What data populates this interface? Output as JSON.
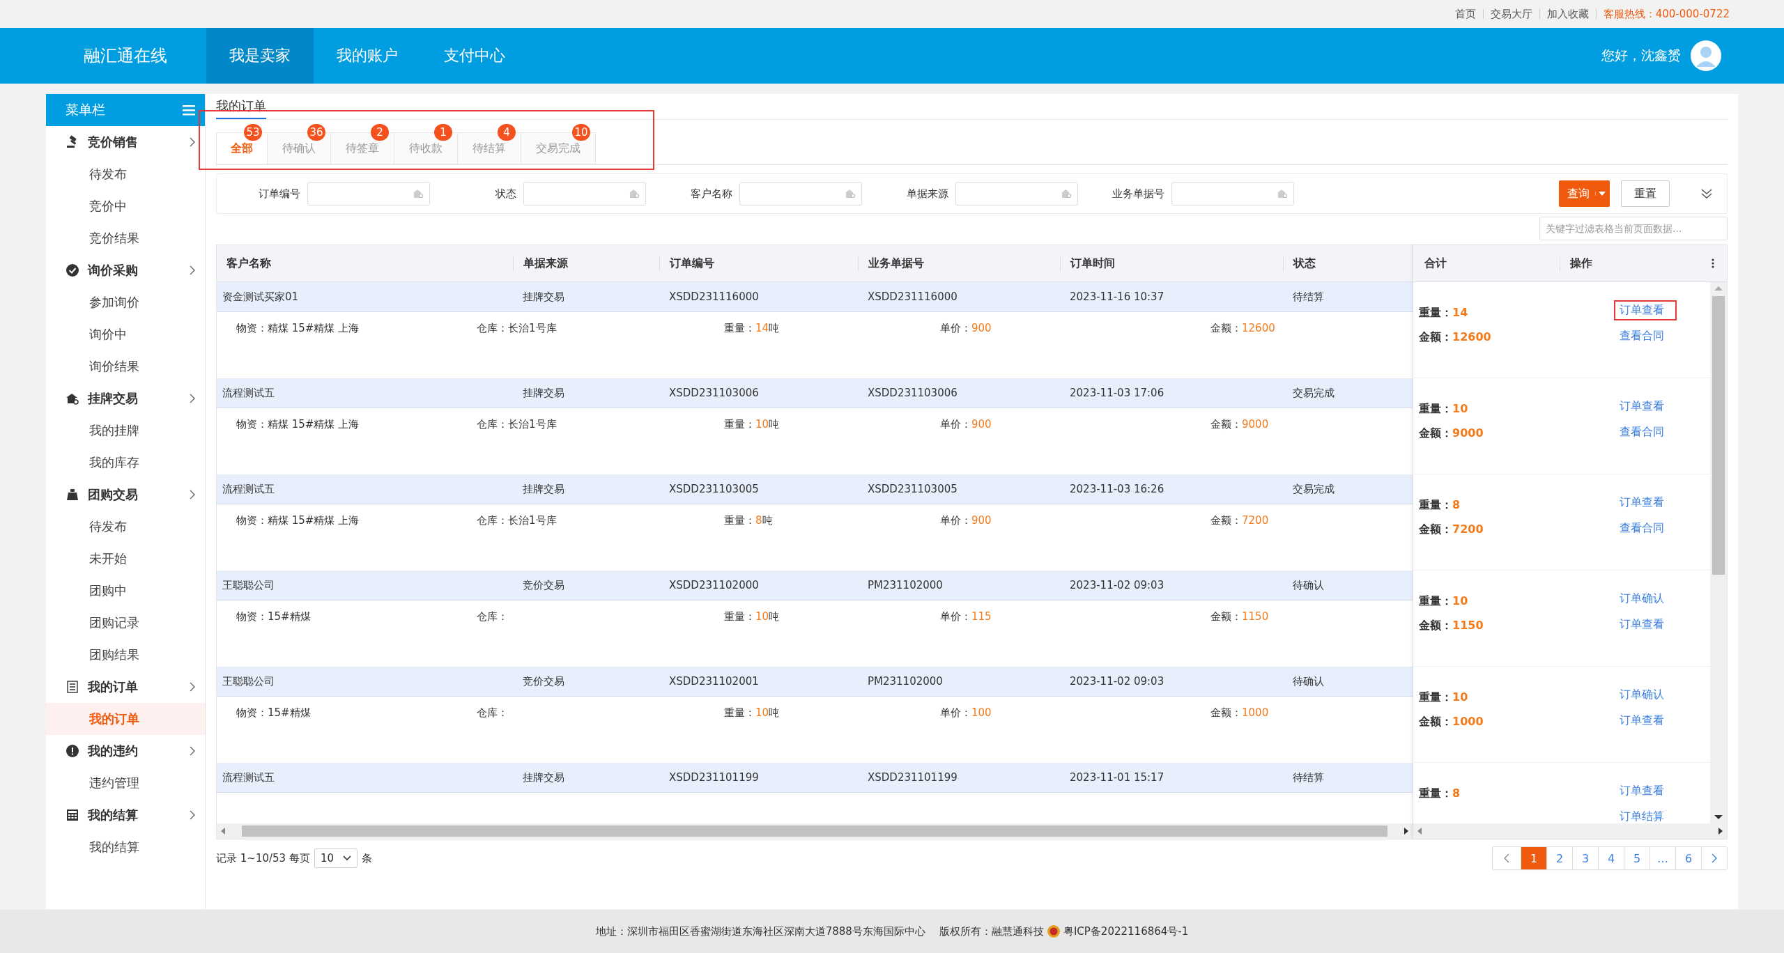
{
  "top_links": [
    {
      "label": "首页"
    },
    {
      "label": "交易大厅"
    },
    {
      "label": "加入收藏"
    }
  ],
  "hotline": "客服热线：400-000-0722",
  "header": {
    "logo": "融汇通在线",
    "nav": [
      {
        "label": "我是卖家",
        "selected": true
      },
      {
        "label": "我的账户",
        "selected": false
      },
      {
        "label": "支付中心",
        "selected": false
      }
    ],
    "greeting": "您好，沈鑫赟"
  },
  "sidebar": {
    "title": "菜单栏",
    "groups": [
      {
        "label": "竞价销售",
        "items": [
          {
            "label": "待发布",
            "selected": false
          },
          {
            "label": "竞价中",
            "selected": false
          },
          {
            "label": "竞价结果",
            "selected": false
          }
        ]
      },
      {
        "label": "询价采购",
        "items": [
          {
            "label": "参加询价",
            "selected": false
          },
          {
            "label": "询价中",
            "selected": false
          },
          {
            "label": "询价结果",
            "selected": false
          }
        ]
      },
      {
        "label": "挂牌交易",
        "items": [
          {
            "label": "我的挂牌",
            "selected": false
          },
          {
            "label": "我的库存",
            "selected": false
          }
        ]
      },
      {
        "label": "团购交易",
        "items": [
          {
            "label": "待发布",
            "selected": false
          },
          {
            "label": "未开始",
            "selected": false
          },
          {
            "label": "团购中",
            "selected": false
          },
          {
            "label": "团购记录",
            "selected": false
          },
          {
            "label": "团购结果",
            "selected": false
          }
        ]
      },
      {
        "label": "我的订单",
        "items": [
          {
            "label": "我的订单",
            "selected": true
          }
        ]
      },
      {
        "label": "我的违约",
        "items": [
          {
            "label": "违约管理",
            "selected": false
          }
        ]
      },
      {
        "label": "我的结算",
        "items": [
          {
            "label": "我的结算",
            "selected": false
          }
        ]
      }
    ]
  },
  "page_tab": "我的订单",
  "status_tabs": {
    "highlighted": true,
    "tabs": [
      {
        "label": "全部",
        "count": "53",
        "selected": true
      },
      {
        "label": "待确认",
        "count": "36",
        "selected": false
      },
      {
        "label": "待签章",
        "count": "2",
        "selected": false
      },
      {
        "label": "待收款",
        "count": "1",
        "selected": false
      },
      {
        "label": "待结算",
        "count": "4",
        "selected": false
      },
      {
        "label": "交易完成",
        "count": "10",
        "selected": false
      }
    ]
  },
  "filters": [
    {
      "label": "订单编号"
    },
    {
      "label": "状态"
    },
    {
      "label": "客户名称"
    },
    {
      "label": "单据来源"
    },
    {
      "label": "业务单据号"
    }
  ],
  "buttons": {
    "query": "查询",
    "reset": "重置"
  },
  "keyword_filter": {
    "placeholder": "关键字过滤表格当前页面数据..."
  },
  "table": {
    "columns": [
      "客户名称",
      "单据来源",
      "订单编号",
      "业务单据号",
      "订单时间",
      "状态"
    ],
    "total_columns": [
      "合计",
      "操作"
    ],
    "rows": [
      {
        "cells": [
          "资金测试买家01",
          "挂牌交易",
          "XSDD231116000",
          "XSDD231116000",
          "2023-11-16 10:37",
          "待结算"
        ],
        "detail": [
          {
            "label": "物资：",
            "value": "精煤 15#精煤 上海",
            "kind": "text"
          },
          {
            "label": "仓库：",
            "value": "长治1号库",
            "kind": "text"
          },
          {
            "label": "重量：",
            "value": "14",
            "unit": "吨",
            "kind": "number"
          },
          {
            "label": "单价：",
            "value": "900",
            "kind": "number"
          },
          {
            "label": "金额：",
            "value": "12600",
            "kind": "number"
          }
        ],
        "totals": [
          {
            "label": "重量：",
            "value": "14"
          },
          {
            "label": "金额：",
            "value": "12600"
          }
        ],
        "actions": [
          {
            "label": "订单查看",
            "highlighted": true
          },
          {
            "label": "查看合同",
            "highlighted": false
          }
        ]
      },
      {
        "cells": [
          "流程测试五",
          "挂牌交易",
          "XSDD231103006",
          "XSDD231103006",
          "2023-11-03 17:06",
          "交易完成"
        ],
        "detail": [
          {
            "label": "物资：",
            "value": "精煤 15#精煤 上海",
            "kind": "text"
          },
          {
            "label": "仓库：",
            "value": "长治1号库",
            "kind": "text"
          },
          {
            "label": "重量：",
            "value": "10",
            "unit": "吨",
            "kind": "number"
          },
          {
            "label": "单价：",
            "value": "900",
            "kind": "number"
          },
          {
            "label": "金额：",
            "value": "9000",
            "kind": "number"
          }
        ],
        "totals": [
          {
            "label": "重量：",
            "value": "10"
          },
          {
            "label": "金额：",
            "value": "9000"
          }
        ],
        "actions": [
          {
            "label": "订单查看",
            "highlighted": false
          },
          {
            "label": "查看合同",
            "highlighted": false
          }
        ]
      },
      {
        "cells": [
          "流程测试五",
          "挂牌交易",
          "XSDD231103005",
          "XSDD231103005",
          "2023-11-03 16:26",
          "交易完成"
        ],
        "detail": [
          {
            "label": "物资：",
            "value": "精煤 15#精煤 上海",
            "kind": "text"
          },
          {
            "label": "仓库：",
            "value": "长治1号库",
            "kind": "text"
          },
          {
            "label": "重量：",
            "value": "8",
            "unit": "吨",
            "kind": "number"
          },
          {
            "label": "单价：",
            "value": "900",
            "kind": "number"
          },
          {
            "label": "金额：",
            "value": "7200",
            "kind": "number"
          }
        ],
        "totals": [
          {
            "label": "重量：",
            "value": "8"
          },
          {
            "label": "金额：",
            "value": "7200"
          }
        ],
        "actions": [
          {
            "label": "订单查看",
            "highlighted": false
          },
          {
            "label": "查看合同",
            "highlighted": false
          }
        ]
      },
      {
        "cells": [
          "王聪聪公司",
          "竞价交易",
          "XSDD231102000",
          "PM231102000",
          "2023-11-02 09:03",
          "待确认"
        ],
        "detail": [
          {
            "label": "物资：",
            "value": "15#精煤",
            "kind": "text"
          },
          {
            "label": "仓库："
          },
          {
            "label": "重量：",
            "value": "10",
            "unit": "吨",
            "kind": "number"
          },
          {
            "label": "单价：",
            "value": "115",
            "kind": "number"
          },
          {
            "label": "金额：",
            "value": "1150",
            "kind": "number"
          }
        ],
        "totals": [
          {
            "label": "重量：",
            "value": "10"
          },
          {
            "label": "金额：",
            "value": "1150"
          }
        ],
        "actions": [
          {
            "label": "订单确认",
            "highlighted": false
          },
          {
            "label": "订单查看",
            "highlighted": false
          }
        ]
      },
      {
        "cells": [
          "王聪聪公司",
          "竞价交易",
          "XSDD231102001",
          "PM231102000",
          "2023-11-02 09:03",
          "待确认"
        ],
        "detail": [
          {
            "label": "物资：",
            "value": "15#精煤",
            "kind": "text"
          },
          {
            "label": "仓库："
          },
          {
            "label": "重量：",
            "value": "10",
            "unit": "吨",
            "kind": "number"
          },
          {
            "label": "单价：",
            "value": "100",
            "kind": "number"
          },
          {
            "label": "金额：",
            "value": "1000",
            "kind": "number"
          }
        ],
        "totals": [
          {
            "label": "重量：",
            "value": "10"
          },
          {
            "label": "金额：",
            "value": "1000"
          }
        ],
        "actions": [
          {
            "label": "订单确认",
            "highlighted": false
          },
          {
            "label": "订单查看",
            "highlighted": false
          }
        ]
      },
      {
        "cells": [
          "流程测试五",
          "挂牌交易",
          "XSDD231101199",
          "XSDD231101199",
          "2023-11-01 15:17",
          "待结算"
        ],
        "totals": [
          {
            "label": "重量：",
            "value": "8"
          }
        ],
        "actions": [
          {
            "label": "订单查看",
            "highlighted": false
          },
          {
            "label": "订单结算",
            "highlighted": false
          }
        ]
      }
    ]
  },
  "pagination": {
    "summary": "记录 1~10/53 每页",
    "page_size": "10",
    "unit": "条",
    "pages": [
      {
        "label": "1",
        "selected": true
      },
      {
        "label": "2",
        "selected": false
      },
      {
        "label": "3",
        "selected": false
      },
      {
        "label": "4",
        "selected": false
      },
      {
        "label": "5",
        "selected": false
      },
      {
        "label": "…",
        "selected": false
      },
      {
        "label": "6",
        "selected": false
      }
    ]
  },
  "footer": {
    "address": "地址：深圳市福田区香蜜湖街道东海社区深南大道7888号东海国际中心",
    "copyright": "版权所有：融慧通科技",
    "icp": "粤ICP备2022116864号-1"
  }
}
